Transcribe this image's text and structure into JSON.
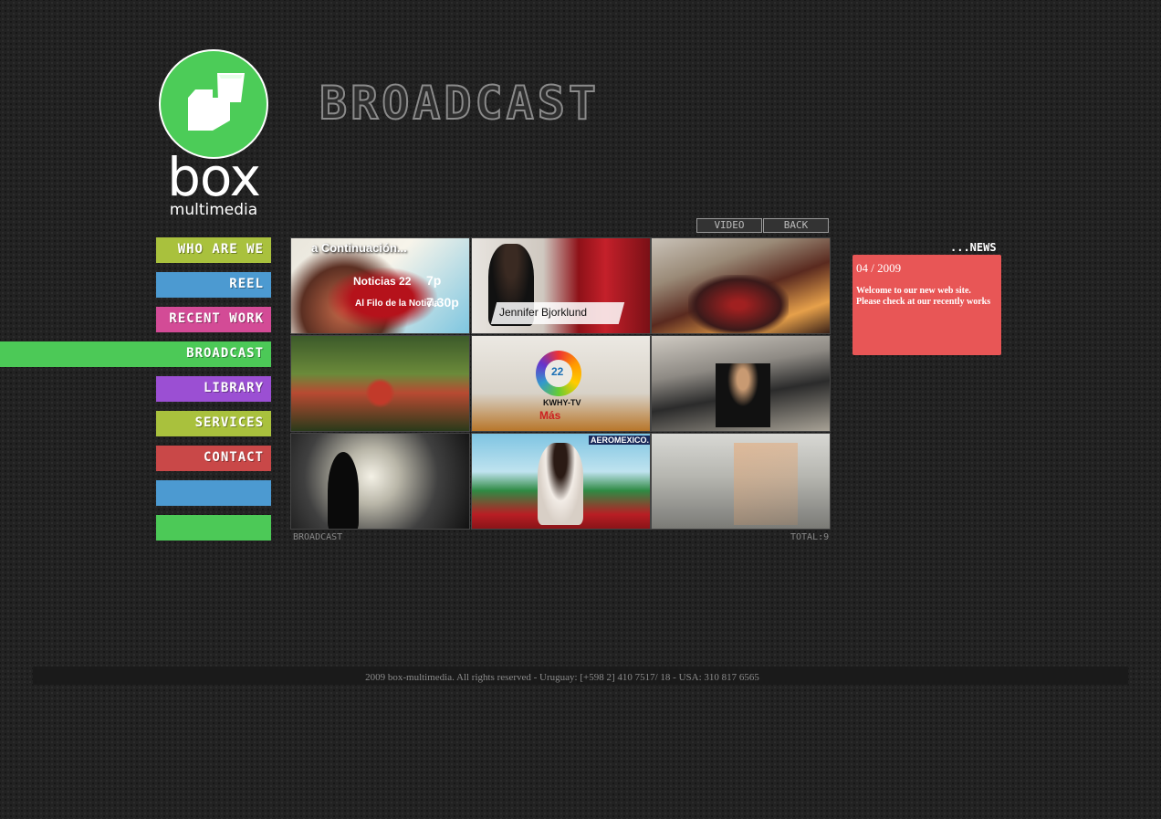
{
  "logo": {
    "word": "box",
    "sub": "multimedia"
  },
  "page": {
    "title": "BROADCAST"
  },
  "nav": [
    {
      "label": "WHO ARE WE",
      "color": "#a9c13d"
    },
    {
      "label": "REEL",
      "color": "#4c9ad1"
    },
    {
      "label": "RECENT WORK",
      "color": "#d34b96"
    },
    {
      "label": "BROADCAST",
      "color": "#4cc957",
      "active": true
    },
    {
      "label": "LIBRARY",
      "color": "#9b4fd3"
    },
    {
      "label": "SERVICES",
      "color": "#a9c13d"
    },
    {
      "label": "CONTACT",
      "color": "#c94848"
    },
    {
      "label": "",
      "color": "#4c9ad1"
    },
    {
      "label": "",
      "color": "#4cc957"
    }
  ],
  "toolbar": {
    "video_label": "VIDEO",
    "back_label": "BACK"
  },
  "gallery": {
    "caption": "BROADCAST",
    "total": "TOTAL:9",
    "thumbs": [
      {
        "texts": [
          "a Continuación...",
          "Noticias 22",
          "7p",
          "Al Filo de la Noticia",
          "7.30p"
        ]
      },
      {
        "texts": [
          "Jennifer Bjorklund"
        ]
      },
      {
        "texts": []
      },
      {
        "texts": []
      },
      {
        "texts": [
          "22",
          "KWHY-TV",
          "Más"
        ]
      },
      {
        "texts": []
      },
      {
        "texts": []
      },
      {
        "texts": [
          "AEROMEXICO."
        ]
      },
      {
        "texts": []
      }
    ]
  },
  "news": {
    "heading": "...NEWS",
    "date": "04 / 2009",
    "text": "Welcome to our new web site. Please check at our recently works"
  },
  "footer": {
    "text": "2009 box-multimedia. All rights reserved - Uruguay: [+598 2] 410 7517/ 18  -  USA: 310 817 6565"
  },
  "colors": {
    "brand_green": "#4ccc58",
    "news_red": "#e85656"
  }
}
